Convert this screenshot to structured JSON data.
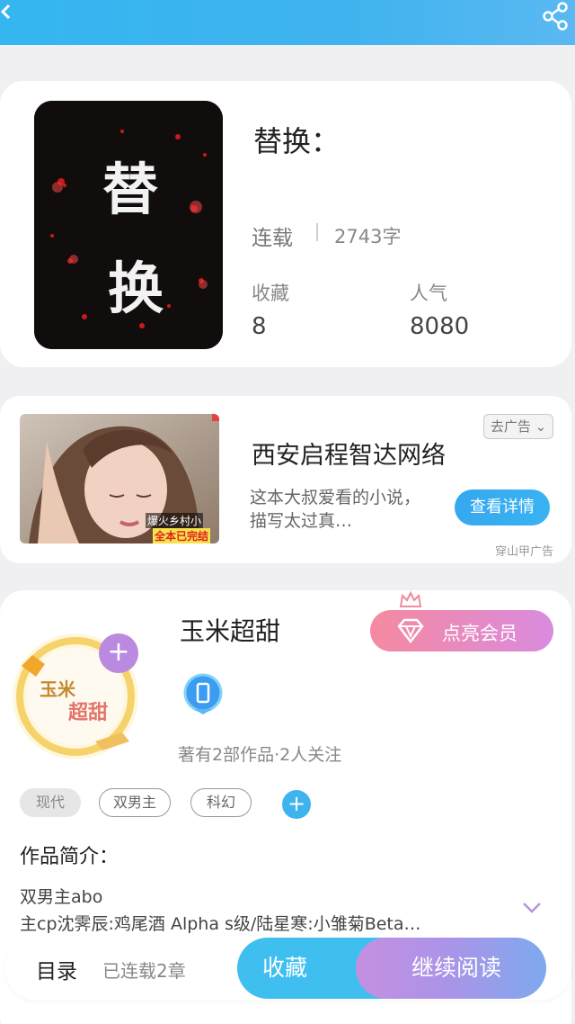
{
  "book": {
    "title": "替换：",
    "cover_text": [
      "替",
      "换"
    ],
    "status": "连载",
    "word_count": "2743字",
    "favorites_label": "收藏",
    "favorites_value": "8",
    "popularity_label": "人气",
    "popularity_value": "8080"
  },
  "ad": {
    "close_label": "去广告 ⌄",
    "title": "西安启程智达网络",
    "description": "这本大叔爱看的小说，描写太过真…",
    "button_label": "查看详情",
    "source": "穿山甲广告",
    "image_caption_top": "爆火乡村小",
    "image_caption_bottom": "全本已完结"
  },
  "author": {
    "name": "玉米超甜",
    "avatar_text": [
      "玉米",
      "超甜"
    ],
    "vip_label": "点亮会员",
    "stats": "著有2部作品·2人关注",
    "tags": [
      "现代",
      "双男主",
      "科幻"
    ]
  },
  "intro": {
    "heading": "作品简介：",
    "line1": "双男主abo",
    "line2": "主cp沈霁辰:鸡尾酒 Alpha  s级/陆星寒:小雏菊Beta…"
  },
  "bottom_bar": {
    "toc_label": "目录",
    "chapters_label": "已连载2章",
    "collect_label": "收藏",
    "read_label": "继续阅读"
  }
}
